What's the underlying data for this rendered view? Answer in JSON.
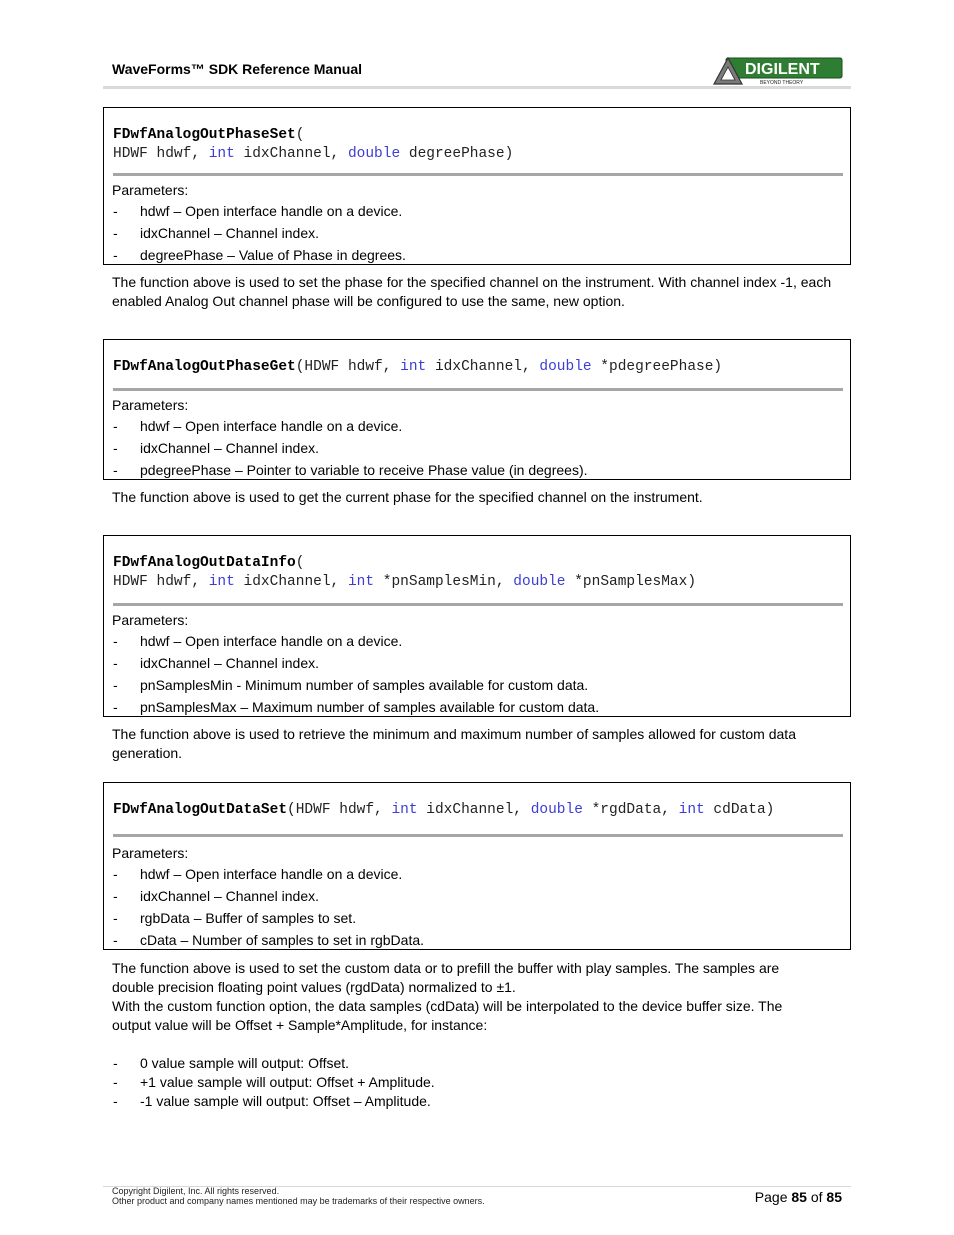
{
  "header": {
    "title": "WaveForms™ SDK Reference Manual",
    "logo_text": "DIGILENT",
    "logo_tagline": "BEYOND THEORY",
    "logo_color": "#2e7d32"
  },
  "functions": [
    {
      "name": "FDwfAnalogOutPhaseSet",
      "signature_line2": [
        {
          "t": "HDWF hdwf, ",
          "k": false
        },
        {
          "t": "int",
          "k": true
        },
        {
          "t": " idxChannel, ",
          "k": false
        },
        {
          "t": "double",
          "k": true
        },
        {
          "t": " degreePhase)",
          "k": false
        }
      ],
      "params_label": "Parameters:",
      "params": [
        "hdwf – Open interface handle on a device.",
        "idxChannel – Channel index.",
        "degreePhase – Value of Phase in degrees."
      ],
      "description": "The function above is used to set the phase for the specified channel on the instrument. With channel index -1, each enabled Analog Out channel phase will be configured to use the same, new option."
    },
    {
      "name": "FDwfAnalogOutPhaseGet",
      "signature_inline": [
        {
          "t": "(HDWF hdwf, ",
          "k": false
        },
        {
          "t": "int",
          "k": true
        },
        {
          "t": " idxChannel, ",
          "k": false
        },
        {
          "t": "double",
          "k": true
        },
        {
          "t": " *pdegreePhase)",
          "k": false
        }
      ],
      "params_label": "Parameters:",
      "params": [
        "hdwf – Open interface handle on a device.",
        "idxChannel – Channel index.",
        "pdegreePhase – Pointer to variable to receive  Phase value (in degrees)."
      ],
      "description": "The function above is used to get the current phase for the specified channel on the instrument."
    },
    {
      "name": "FDwfAnalogOutDataInfo",
      "signature_line2": [
        {
          "t": "HDWF hdwf, ",
          "k": false
        },
        {
          "t": "int",
          "k": true
        },
        {
          "t": " idxChannel, ",
          "k": false
        },
        {
          "t": "int",
          "k": true
        },
        {
          "t": " *pnSamplesMin, ",
          "k": false
        },
        {
          "t": "double",
          "k": true
        },
        {
          "t": " *pnSamplesMax)",
          "k": false
        }
      ],
      "params_label": "Parameters:",
      "params": [
        "hdwf – Open interface handle on a device.",
        "idxChannel – Channel index.",
        "pnSamplesMin - Minimum number of samples available for custom data.",
        "pnSamplesMax – Maximum number of samples available for custom data."
      ],
      "description": "The function above is used to retrieve the minimum and maximum number of samples allowed for custom data generation."
    },
    {
      "name": "FDwfAnalogOutDataSet",
      "signature_inline": [
        {
          "t": "(HDWF hdwf, ",
          "k": false
        },
        {
          "t": "int",
          "k": true
        },
        {
          "t": " idxChannel, ",
          "k": false
        },
        {
          "t": "double",
          "k": true
        },
        {
          "t": " *rgdData, ",
          "k": false
        },
        {
          "t": "int",
          "k": true
        },
        {
          "t": " cdData)",
          "k": false
        }
      ],
      "params_label": "Parameters:",
      "params": [
        "hdwf – Open interface handle on a device.",
        "idxChannel – Channel index.",
        "rgbData – Buffer of samples to set.",
        "cData – Number of samples to set in rgbData."
      ],
      "description_lines": [
        "The function above is used to set the custom data or to prefill the buffer with play samples. The samples are",
        "double precision floating point values (rgdData) normalized to ±1.",
        "With the custom function option, the data samples (cdData) will be interpolated to the device buffer size. The",
        "output value will be Offset + Sample*Amplitude, for instance:"
      ],
      "bullets": [
        "0 value sample will output: Offset.",
        "+1 value sample will output: Offset + Amplitude.",
        "-1 value sample will output: Offset – Amplitude."
      ]
    }
  ],
  "footer": {
    "copyright": "Copyright Digilent, Inc. All rights reserved.",
    "trademarks": "Other product and company names mentioned may be trademarks of their respective owners.",
    "page_prefix": "Page ",
    "page_current": "85",
    "page_of": " of ",
    "page_total": "85"
  }
}
